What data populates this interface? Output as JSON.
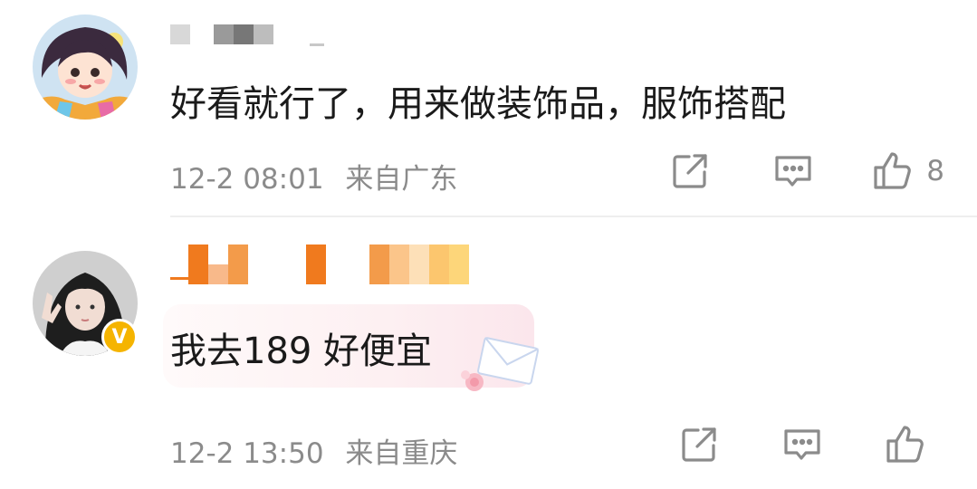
{
  "comments": [
    {
      "text": "好看就行了，用来做装饰品，服饰搭配",
      "time": "12-2 08:01",
      "location": "来自广东",
      "like_count": "8",
      "icons": {
        "share": "share-icon",
        "comment": "comment-icon",
        "like": "thumbs-up-icon"
      }
    },
    {
      "text": "我去189 好便宜",
      "time": "12-2 13:50",
      "location": "来自重庆",
      "like_count": "",
      "verified_badge": "V",
      "icons": {
        "share": "share-icon",
        "comment": "comment-icon",
        "like": "thumbs-up-icon"
      }
    }
  ],
  "colors": {
    "text": "#1a1a1a",
    "meta": "#8b8b8b",
    "icon": "#8b8b8b",
    "username_pixels_orange": "#f07a1e",
    "verified_badge": "#f5b400",
    "bubble_pink": "#fbe6ec"
  }
}
